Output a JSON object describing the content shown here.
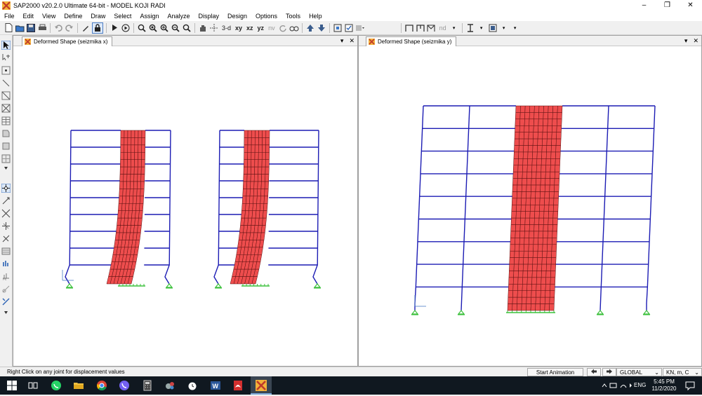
{
  "window": {
    "title": "SAP2000 v20.2.0 Ultimate 64-bit - MODEL KOJI RADI",
    "controls": {
      "minimize": "–",
      "restore": "❐",
      "close": "✕"
    }
  },
  "menu": [
    "File",
    "Edit",
    "View",
    "Define",
    "Draw",
    "Select",
    "Assign",
    "Analyze",
    "Display",
    "Design",
    "Options",
    "Tools",
    "Help"
  ],
  "toolbar": {
    "view_3d": "3-d",
    "view_xy": "xy",
    "view_xz": "xz",
    "view_yz": "yz",
    "view_nv": "nv",
    "nd_label": "nd"
  },
  "panels": {
    "left": {
      "tab_label": "Deformed Shape (seizmika x)",
      "dropdown": "▾",
      "close": "✕"
    },
    "right": {
      "tab_label": "Deformed Shape (seizmika y)",
      "dropdown": "▾",
      "close": "✕"
    }
  },
  "status": {
    "message": "Right Click on any joint for displacement values",
    "start_animation": "Start Animation",
    "coord_system": "GLOBAL",
    "units": "KN, m, C"
  },
  "taskbar": {
    "language": "ENG",
    "time": "5:45 PM",
    "date": "11/2/2020"
  },
  "colors": {
    "frame": "#1c1cb4",
    "wall_fill": "#ee4d4d",
    "wall_mesh": "#5a1010",
    "support": "#3cc03c",
    "taskbar_bg": "#101820"
  },
  "icons": [
    "sap2000-icon",
    "new-file-icon",
    "open-icon",
    "save-icon",
    "print-icon",
    "undo-icon",
    "redo-icon",
    "pencil-icon",
    "lock-icon",
    "run-icon",
    "zoom-icon",
    "pan-hand-icon",
    "rotate-icon",
    "pointer-icon",
    "windows-start-icon",
    "whatsapp-icon",
    "chrome-icon",
    "viber-icon",
    "calculator-icon",
    "word-icon",
    "pdf-icon"
  ]
}
